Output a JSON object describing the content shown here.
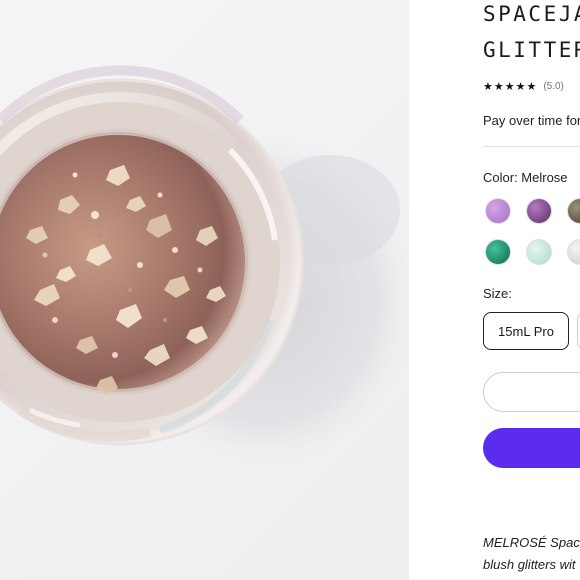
{
  "product": {
    "title_line1": "SPACEJA",
    "title_line2": "GLITTER",
    "stars": "★★★★★",
    "rating": "(5.0)",
    "pay_text": "Pay over time for"
  },
  "color": {
    "label": "Color: Melrose",
    "swatches": [
      {
        "name": "lavender",
        "colors": [
          "#d2a6e6",
          "#a56fc8"
        ]
      },
      {
        "name": "violet",
        "colors": [
          "#b47ac0",
          "#5e2c6c"
        ]
      },
      {
        "name": "olive",
        "colors": [
          "#9c927a",
          "#3f3a33"
        ]
      },
      {
        "name": "emerald",
        "colors": [
          "#42c19d",
          "#0e6b4c"
        ]
      },
      {
        "name": "opal-mint",
        "colors": [
          "#e6f6ef",
          "#a8dcca"
        ]
      },
      {
        "name": "silver",
        "colors": [
          "#f6f6f6",
          "#c6c6c6"
        ]
      }
    ]
  },
  "size": {
    "label": "Size:",
    "options": [
      "15mL Pro"
    ]
  },
  "cta": {
    "primary_color": "#5b2bee"
  },
  "description": {
    "line1": "MELROSÉ Space",
    "line2": "blush glitters wit"
  },
  "photo": {
    "alt": "jar of rose gold glitter gel"
  }
}
